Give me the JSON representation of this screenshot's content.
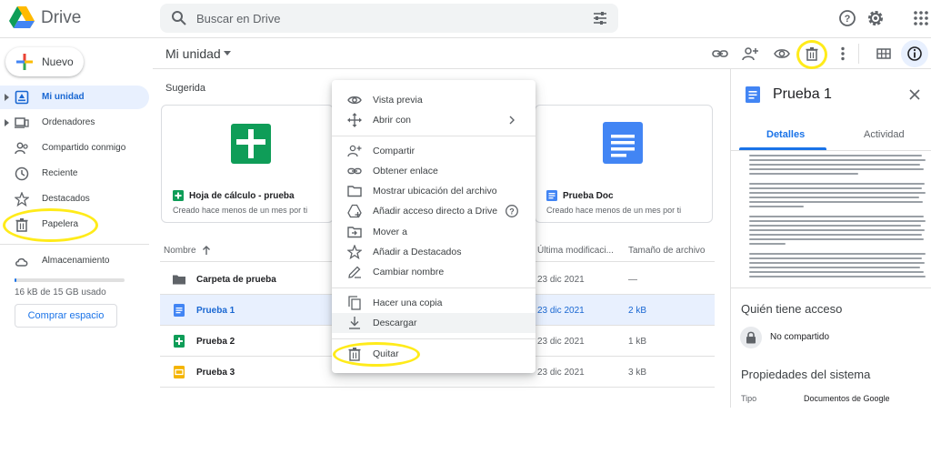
{
  "app": {
    "name": "Drive"
  },
  "search": {
    "placeholder": "Buscar en Drive"
  },
  "sidebar": {
    "new_label": "Nuevo",
    "items": [
      {
        "label": "Mi unidad",
        "icon": "my-drive-icon",
        "active": true
      },
      {
        "label": "Ordenadores",
        "icon": "computers-icon"
      },
      {
        "label": "Compartido conmigo",
        "icon": "shared-with-me-icon"
      },
      {
        "label": "Reciente",
        "icon": "clock-icon"
      },
      {
        "label": "Destacados",
        "icon": "star-icon"
      },
      {
        "label": "Papelera",
        "icon": "trash-icon"
      }
    ],
    "storage_label": "Almacenamiento",
    "storage_used": "16 kB de 15 GB usado",
    "storage_fraction": 0.02,
    "buy_label": "Comprar espacio"
  },
  "toolbar": {
    "title": "Mi unidad"
  },
  "main": {
    "suggested_label": "Sugerida",
    "cards": [
      {
        "name": "Hoja de cálculo - prueba",
        "sub": "Creado hace menos de un mes por ti",
        "type": "sheet"
      },
      {
        "name": "Prueba Doc",
        "sub": "Creado hace menos de un mes por ti",
        "type": "doc"
      }
    ],
    "columns": {
      "name": "Nombre",
      "modified": "Última modificaci...",
      "size": "Tamaño de archivo"
    },
    "files": [
      {
        "name": "Carpeta de prueba",
        "type": "folder",
        "modified": "23 dic 2021",
        "size": "—"
      },
      {
        "name": "Prueba 1",
        "type": "doc",
        "modified": "23 dic 2021",
        "size": "2 kB",
        "selected": true
      },
      {
        "name": "Prueba 2",
        "type": "sheet",
        "modified": "23 dic 2021",
        "size": "1 kB"
      },
      {
        "name": "Prueba 3",
        "type": "slides",
        "modified": "23 dic 2021",
        "size": "3 kB"
      }
    ]
  },
  "context_menu": {
    "items": [
      {
        "label": "Vista previa",
        "icon": "eye-icon"
      },
      {
        "label": "Abrir con",
        "icon": "open-with-icon",
        "submenu": true
      },
      {
        "label": "Compartir",
        "icon": "share-icon"
      },
      {
        "label": "Obtener enlace",
        "icon": "link-icon"
      },
      {
        "label": "Mostrar ubicación del archivo",
        "icon": "folder-icon"
      },
      {
        "label": "Añadir acceso directo a Drive",
        "icon": "shortcut-icon",
        "help": true
      },
      {
        "label": "Mover a",
        "icon": "move-icon"
      },
      {
        "label": "Añadir a Destacados",
        "icon": "star-icon"
      },
      {
        "label": "Cambiar nombre",
        "icon": "rename-icon"
      },
      {
        "label": "Hacer una copia",
        "icon": "copy-icon"
      },
      {
        "label": "Descargar",
        "icon": "download-icon",
        "highlighted": true
      },
      {
        "label": "Quitar",
        "icon": "trash-icon"
      }
    ]
  },
  "details": {
    "title": "Prueba 1",
    "tabs": [
      {
        "label": "Detalles",
        "active": true
      },
      {
        "label": "Actividad"
      }
    ],
    "access_heading": "Quién tiene acceso",
    "access_status": "No compartido",
    "props_heading": "Propiedades del sistema",
    "type_key": "Tipo",
    "type_value": "Documentos de Google"
  },
  "colors": {
    "accent": "#1a73e8",
    "highlight": "#ffeb1a",
    "selected_bg": "#e8f0fe"
  }
}
